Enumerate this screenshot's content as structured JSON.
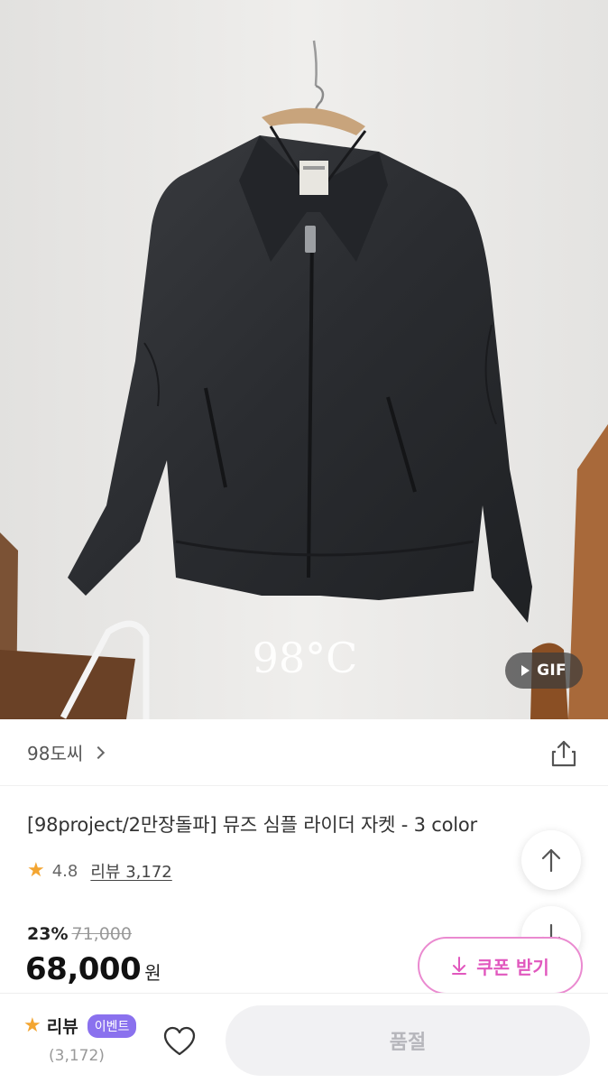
{
  "hero": {
    "brand_watermark": "98°C",
    "gif_label": "GIF"
  },
  "shop": {
    "name": "98도씨"
  },
  "product": {
    "title": "[98project/2만장돌파] 뮤즈 심플 라이더 자켓 - 3 color",
    "rating": "4.8",
    "review_link": "리뷰 3,172",
    "discount_rate": "23%",
    "original_price": "71,000",
    "price": "68,000",
    "currency": "원"
  },
  "coupon": {
    "label": "쿠폰 받기"
  },
  "bottom_bar": {
    "review_label": "리뷰",
    "event_badge": "이벤트",
    "review_count": "(3,172)",
    "soldout_label": "품절"
  },
  "icons": {
    "share": "share-icon",
    "scroll_up": "arrow-up-icon",
    "scroll_down": "arrow-down-icon",
    "coupon": "download-icon",
    "wishlist": "heart-icon",
    "star": "star-icon",
    "chevron": "chevron-right-icon"
  },
  "colors": {
    "star": "#f3a531",
    "coupon_accent": "#e158be",
    "event_badge": "#8a71ee",
    "soldout_bg": "#f1f1f3"
  }
}
